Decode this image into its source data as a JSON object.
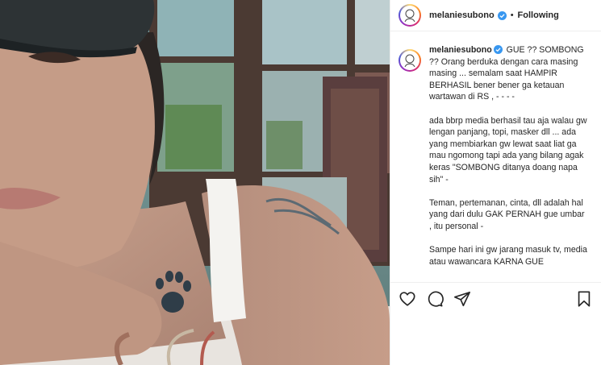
{
  "post": {
    "image_alt": "photo",
    "author": {
      "username": "melaniesubono",
      "verified": true
    },
    "header": {
      "separator": "•",
      "follow_state": "Following"
    },
    "caption": {
      "username": "melaniesubono",
      "paragraphs": [
        "GUE ?? SOMBONG ?? Orang berduka dengan cara masing masing ... semalam saat HAMPIR BERHASIL bener bener ga ketauan wartawan di RS , - - - -",
        "ada bbrp media berhasil tau aja walau gw lengan panjang, topi, masker dll ... ada yang membiarkan gw lewat saat liat ga mau ngomong tapi ada yang bilang agak keras \"SOMBONG ditanya doang napa sih\" -",
        "Teman, pertemanan, cinta, dll adalah hal yang dari dulu GAK PERNAH gue umbar , itu personal -",
        "Sampe hari ini gw jarang masuk tv, media atau wawancara KARNA GUE"
      ]
    },
    "actions": {
      "like": "heart-icon",
      "comment": "comment-icon",
      "share": "share-icon",
      "save": "bookmark-icon"
    }
  }
}
